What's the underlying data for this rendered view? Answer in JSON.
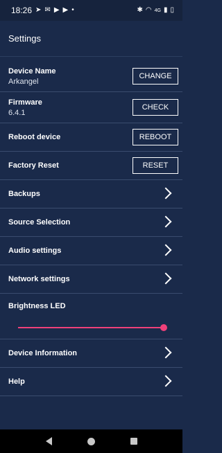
{
  "status": {
    "time": "18:26",
    "left_icons": [
      "send-icon",
      "gmail-icon",
      "youtube-icon",
      "youtube-icon",
      "dot-icon"
    ],
    "right_icons": [
      "bluetooth-icon",
      "wifi-icon",
      "signal-icon",
      "battery-icon"
    ],
    "network_label": "4G"
  },
  "app_bar": {
    "title": "Settings"
  },
  "settings": {
    "device_name": {
      "title": "Device Name",
      "value": "Arkangel",
      "button": "CHANGE"
    },
    "firmware": {
      "title": "Firmware",
      "value": "6.4.1",
      "button": "CHECK"
    },
    "reboot": {
      "title": "Reboot device",
      "button": "REBOOT"
    },
    "factory_reset": {
      "title": "Factory Reset",
      "button": "RESET"
    },
    "backups": {
      "title": "Backups"
    },
    "source_selection": {
      "title": "Source Selection"
    },
    "audio_settings": {
      "title": "Audio settings"
    },
    "network_settings": {
      "title": "Network settings"
    },
    "brightness": {
      "title": "Brightness LED",
      "level_percent": 100
    },
    "device_information": {
      "title": "Device Information"
    },
    "help": {
      "title": "Help"
    }
  },
  "colors": {
    "background": "#1a2a4a",
    "accent": "#f0407a",
    "divider": "#3a4c6e"
  }
}
